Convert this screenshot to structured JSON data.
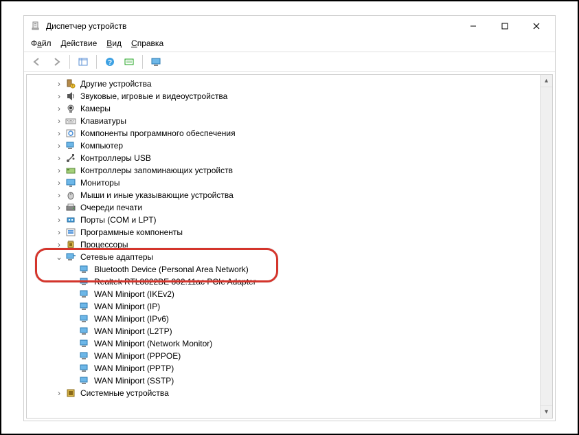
{
  "window": {
    "title": "Диспетчер устройств",
    "minimize": "—",
    "maximize": "▢",
    "close": "✕"
  },
  "menu": {
    "file": {
      "pre": "Ф",
      "u": "а",
      "post": "йл"
    },
    "action": {
      "pre": "",
      "u": "Д",
      "post": "ействие"
    },
    "view": {
      "pre": "",
      "u": "В",
      "post": "ид"
    },
    "help": {
      "pre": "",
      "u": "С",
      "post": "правка"
    }
  },
  "tree": {
    "depth1_collapsed": [
      {
        "icon": "other",
        "label": "Другие устройства"
      },
      {
        "icon": "audio",
        "label": "Звуковые, игровые и видеоустройства"
      },
      {
        "icon": "camera",
        "label": "Камеры"
      },
      {
        "icon": "keyboard",
        "label": "Клавиатуры"
      },
      {
        "icon": "software",
        "label": "Компоненты программного обеспечения"
      },
      {
        "icon": "computer",
        "label": "Компьютер"
      },
      {
        "icon": "usb",
        "label": "Контроллеры USB"
      },
      {
        "icon": "storage",
        "label": "Контроллеры запоминающих устройств"
      },
      {
        "icon": "monitor",
        "label": "Мониторы"
      },
      {
        "icon": "mouse",
        "label": "Мыши и иные указывающие устройства"
      },
      {
        "icon": "printqueue",
        "label": "Очереди печати"
      },
      {
        "icon": "ports",
        "label": "Порты (COM и LPT)"
      },
      {
        "icon": "swcomp",
        "label": "Программные компоненты"
      },
      {
        "icon": "cpu",
        "label": "Процессоры"
      }
    ],
    "network_label": "Сетевые адаптеры",
    "network_children": [
      "Bluetooth Device (Personal Area Network)",
      "Realtek RTL8822BE 802.11ac PCIe Adapter",
      "WAN Miniport (IKEv2)",
      "WAN Miniport (IP)",
      "WAN Miniport (IPv6)",
      "WAN Miniport (L2TP)",
      "WAN Miniport (Network Monitor)",
      "WAN Miniport (PPPOE)",
      "WAN Miniport (PPTP)",
      "WAN Miniport (SSTP)"
    ],
    "trailing_collapsed": [
      {
        "icon": "system",
        "label": "Системные устройства"
      }
    ]
  },
  "glyphs": {
    "collapsed": "›",
    "expanded": "⌄",
    "blank": ""
  }
}
